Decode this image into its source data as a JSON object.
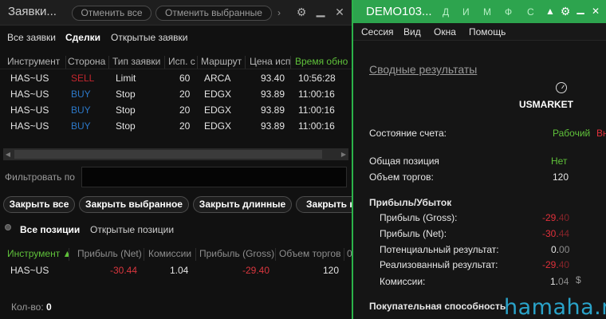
{
  "left": {
    "title": "Заявки...",
    "btn_cancel_all": "Отменить все",
    "btn_cancel_selected": "Отменить выбранные",
    "tabs": [
      "Все заявки",
      "Сделки",
      "Открытые заявки"
    ],
    "columns": [
      "Инструмент",
      "Сторона",
      "Тип заявки",
      "Исп. с",
      "Маршрут",
      "Цена исп",
      "Время обно"
    ],
    "rows": [
      {
        "instrument": "HAS~US",
        "side": "SELL",
        "type": "Limit",
        "qty": "60",
        "route": "ARCA",
        "price": "93.40",
        "time": "10:56:28"
      },
      {
        "instrument": "HAS~US",
        "side": "BUY",
        "type": "Stop",
        "qty": "20",
        "route": "EDGX",
        "price": "93.89",
        "time": "11:00:16"
      },
      {
        "instrument": "HAS~US",
        "side": "BUY",
        "type": "Stop",
        "qty": "20",
        "route": "EDGX",
        "price": "93.89",
        "time": "11:00:16"
      },
      {
        "instrument": "HAS~US",
        "side": "BUY",
        "type": "Stop",
        "qty": "20",
        "route": "EDGX",
        "price": "93.89",
        "time": "11:00:16"
      }
    ],
    "filter_label": "Фильтровать по",
    "filter_value": "",
    "close_buttons": [
      "Закрыть все",
      "Закрыть выбранное",
      "Закрыть длинные",
      "Закрыть к"
    ],
    "pos_tabs": [
      "Все позиции",
      "Открытые позиции"
    ],
    "pos_columns": [
      "Инструмент",
      "Прибыль (Net)",
      "Комиссии",
      "Прибыль (Gross)",
      "Объем торгов",
      "0"
    ],
    "pos_row": {
      "instrument": "HAS~US",
      "net": "-30.44",
      "commission": "1.04",
      "gross": "-29.40",
      "volume": "120"
    },
    "count_label": "Кол-во:",
    "count_value": "0"
  },
  "right": {
    "title": "DEMO103...",
    "title_letters": [
      "Д",
      "И",
      "М",
      "Ф",
      "С"
    ],
    "menu": [
      "Сессия",
      "Вид",
      "Окна",
      "Помощь"
    ],
    "heading": "Сводные результаты",
    "market": "USMARKET",
    "account_state_label": "Состояние счета:",
    "account_state_value": "Рабочий",
    "account_state_cut": "Вн",
    "position_label": "Общая позиция",
    "position_value": "Нет",
    "volume_label": "Объем торгов:",
    "volume_value": "120",
    "pnl_heading": "Прибыль/Убыток",
    "gross_label": "Прибыль (Gross):",
    "gross_main": "-29.",
    "gross_dim": "40",
    "net_label": "Прибыль (Net):",
    "net_main": "-30.",
    "net_dim": "44",
    "potential_label": "Потенциальный результат:",
    "potential_main": "0.",
    "potential_dim": "00",
    "realized_label": "Реализованный результат:",
    "realized_main": "-29.",
    "realized_dim": "40",
    "commission_label": "Комиссии:",
    "commission_main": "1.",
    "commission_dim": "04",
    "currency": "$",
    "buying_power_heading": "Покупательная способность",
    "watermark": "hamaha.net"
  },
  "colors": {
    "sell": "#c4262e",
    "buy": "#2c78c8",
    "accent_green": "#2da44e",
    "loss": "#e0303a",
    "state_green": "#5fc13a"
  }
}
